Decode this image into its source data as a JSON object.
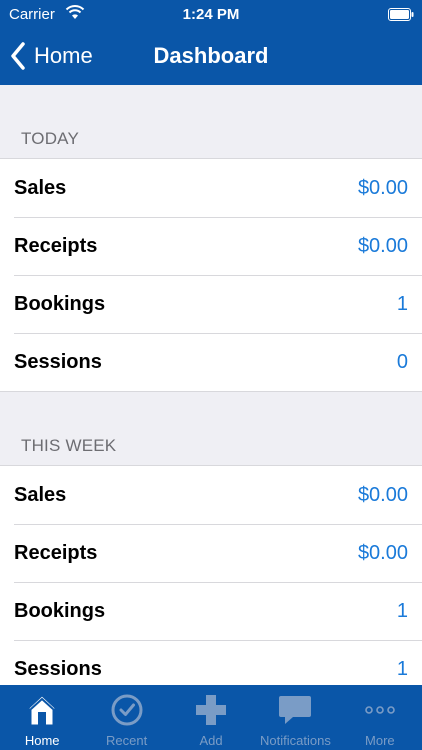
{
  "status_bar": {
    "carrier": "Carrier",
    "time": "1:24 PM"
  },
  "nav": {
    "back_label": "Home",
    "title": "Dashboard"
  },
  "sections": [
    {
      "header": "TODAY",
      "rows": [
        {
          "label": "Sales",
          "value": "$0.00"
        },
        {
          "label": "Receipts",
          "value": "$0.00"
        },
        {
          "label": "Bookings",
          "value": "1"
        },
        {
          "label": "Sessions",
          "value": "0"
        }
      ]
    },
    {
      "header": "THIS WEEK",
      "rows": [
        {
          "label": "Sales",
          "value": "$0.00"
        },
        {
          "label": "Receipts",
          "value": "$0.00"
        },
        {
          "label": "Bookings",
          "value": "1"
        },
        {
          "label": "Sessions",
          "value": "1"
        }
      ]
    }
  ],
  "tabbar": {
    "items": [
      {
        "label": "Home",
        "icon": "house-icon"
      },
      {
        "label": "Recent",
        "icon": "clock-icon"
      },
      {
        "label": "Add",
        "icon": "plus-icon"
      },
      {
        "label": "Notifications",
        "icon": "speech-bubble-icon"
      },
      {
        "label": "More",
        "icon": "more-dots-icon"
      }
    ],
    "active_index": 0
  },
  "colors": {
    "brand": "#0a56a8",
    "value_text": "#1a7ad9",
    "background": "#efeff4",
    "tab_inactive": "#7a9cc6"
  }
}
